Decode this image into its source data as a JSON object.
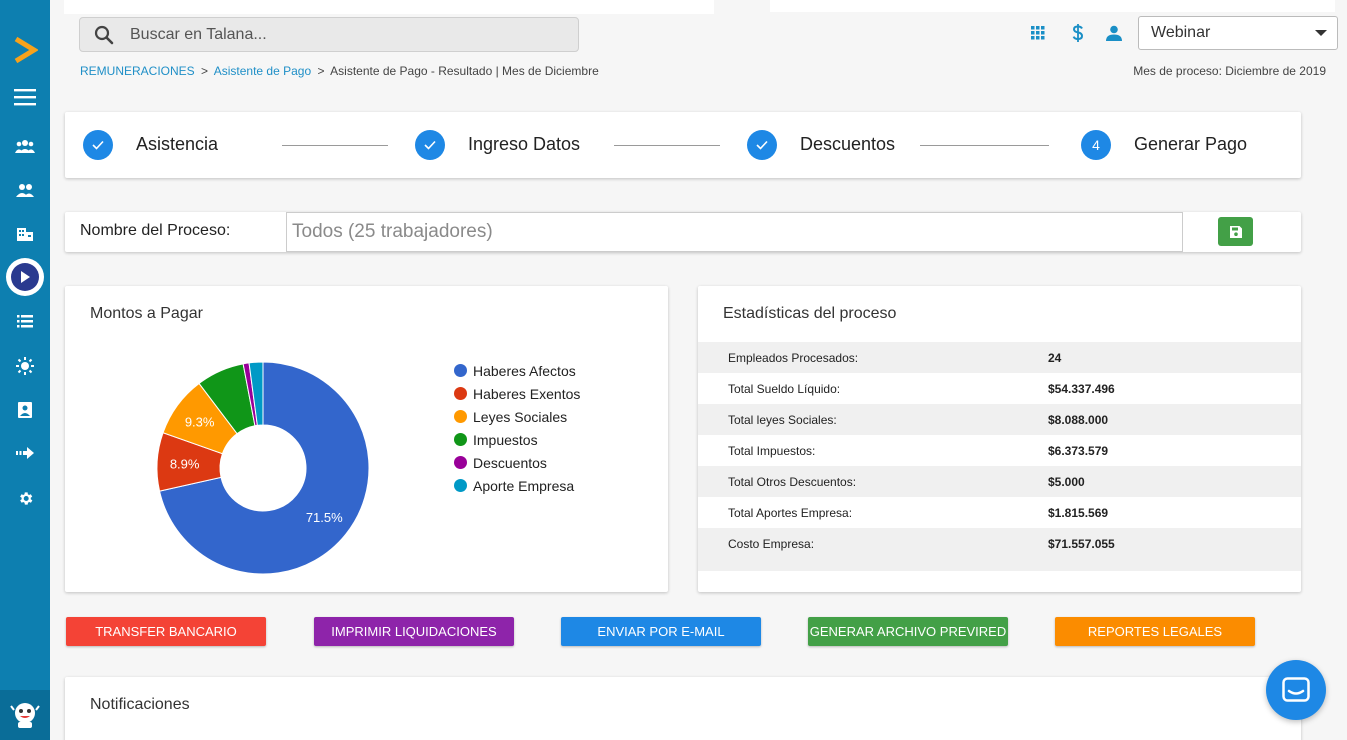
{
  "search": {
    "placeholder": "Buscar en Talana..."
  },
  "header": {
    "company_select": "Webinar"
  },
  "breadcrumb": {
    "items": [
      "REMUNERACIONES",
      "Asistente de Pago"
    ],
    "current": "Asistente de Pago - Resultado | Mes de Diciembre",
    "separator": ">"
  },
  "process_month": "Mes de proceso: Diciembre de 2019",
  "stepper": {
    "steps": [
      {
        "label": "Asistencia",
        "state": "done"
      },
      {
        "label": "Ingreso Datos",
        "state": "done"
      },
      {
        "label": "Descuentos",
        "state": "done"
      },
      {
        "label": "Generar Pago",
        "state": "current",
        "number": "4"
      }
    ]
  },
  "process": {
    "label": "Nombre del Proceso:",
    "value": "Todos (25 trabajadores)"
  },
  "pie_card": {
    "title": "Montos a Pagar"
  },
  "chart_data": {
    "type": "pie",
    "donut": true,
    "series": [
      {
        "name": "Haberes Afectos",
        "value": 71.5,
        "label": "71.5%",
        "color": "#3366cc"
      },
      {
        "name": "Haberes Exentos",
        "value": 8.9,
        "label": "8.9%",
        "color": "#dc3912"
      },
      {
        "name": "Leyes Sociales",
        "value": 9.3,
        "label": "9.3%",
        "color": "#ff9900"
      },
      {
        "name": "Impuestos",
        "value": 7.3,
        "label": "",
        "color": "#109618"
      },
      {
        "name": "Descuentos",
        "value": 0.9,
        "label": "",
        "color": "#990099"
      },
      {
        "name": "Aporte Empresa",
        "value": 2.1,
        "label": "",
        "color": "#0099c6"
      }
    ],
    "legend_position": "right"
  },
  "stats_card": {
    "title": "Estadísticas del proceso",
    "rows": [
      {
        "label": "Empleados Procesados:",
        "value": "24"
      },
      {
        "label": "Total Sueldo Líquido:",
        "value": "$54.337.496"
      },
      {
        "label": "Total leyes Sociales:",
        "value": "$8.088.000"
      },
      {
        "label": "Total Impuestos:",
        "value": "$6.373.579"
      },
      {
        "label": "Total Otros Descuentos:",
        "value": "$5.000"
      },
      {
        "label": "Total Aportes Empresa:",
        "value": "$1.815.569"
      },
      {
        "label": "Costo Empresa:",
        "value": "$71.557.055"
      }
    ]
  },
  "actions": [
    {
      "label": "TRANSFER BANCARIO",
      "color": "#f44336"
    },
    {
      "label": "IMPRIMIR LIQUIDACIONES",
      "color": "#8e24aa"
    },
    {
      "label": "ENVIAR POR E-MAIL",
      "color": "#1e88e5"
    },
    {
      "label": "GENERAR ARCHIVO PREVIRED",
      "color": "#43a047"
    },
    {
      "label": "REPORTES LEGALES",
      "color": "#fb8c00"
    }
  ],
  "notifications": {
    "title": "Notificaciones"
  },
  "icons": {
    "sidebar": [
      "talana-logo-icon",
      "menu-icon",
      "group-icon",
      "people-icon",
      "building-icon",
      "play-icon",
      "list-icon",
      "sun-icon",
      "photo-badge-icon",
      "arrow-forward-icon",
      "settings-icon",
      "mascot-icon"
    ],
    "top": [
      "apps-grid-icon",
      "dollar-icon",
      "person-icon"
    ]
  }
}
